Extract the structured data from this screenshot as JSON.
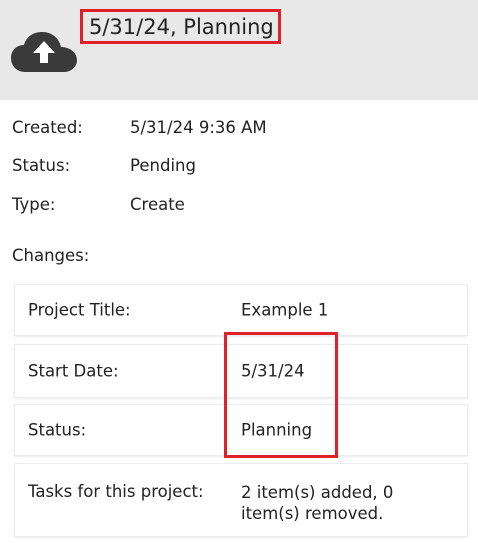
{
  "header": {
    "icon": "cloud-upload-icon",
    "title": "5/31/24, Planning"
  },
  "info": [
    {
      "label": "Created:",
      "value": "5/31/24 9:36 AM"
    },
    {
      "label": "Status:",
      "value": "Pending"
    },
    {
      "label": "Type:",
      "value": "Create"
    }
  ],
  "changes": {
    "label": "Changes:",
    "items": [
      {
        "label": "Project Title:",
        "value": "Example 1"
      },
      {
        "label": "Start Date:",
        "value": "5/31/24"
      },
      {
        "label": "Status:",
        "value": "Planning"
      },
      {
        "label": "Tasks for this project:",
        "value": "2 item(s) added, 0 item(s) removed."
      }
    ]
  },
  "colors": {
    "header_bg": "#e8e8e8",
    "highlight": "#e0202a",
    "icon": "#3a3a3a"
  }
}
